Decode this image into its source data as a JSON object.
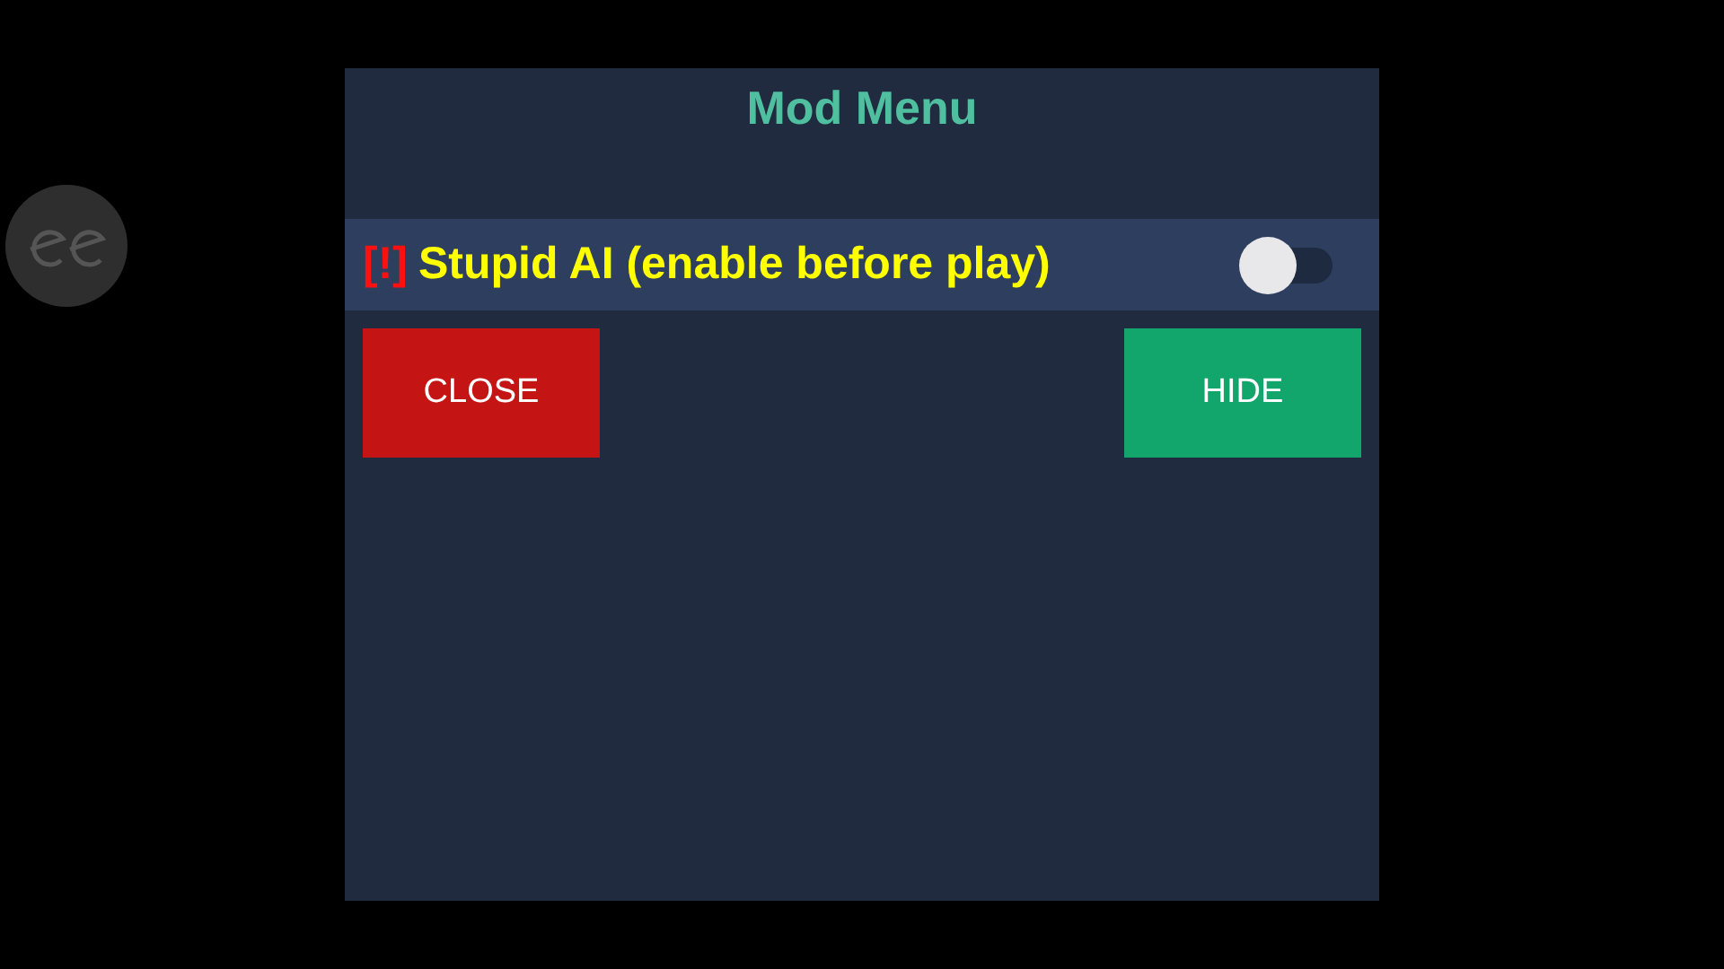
{
  "menu": {
    "title": "Mod Menu",
    "options": [
      {
        "kind": "switch",
        "warning": "[!]",
        "label": "Stupid AI (enable before play)",
        "on": false
      }
    ],
    "buttons": [
      {
        "kind": "close",
        "label": "CLOSE"
      },
      {
        "kind": "hide",
        "label": "HIDE"
      }
    ]
  }
}
